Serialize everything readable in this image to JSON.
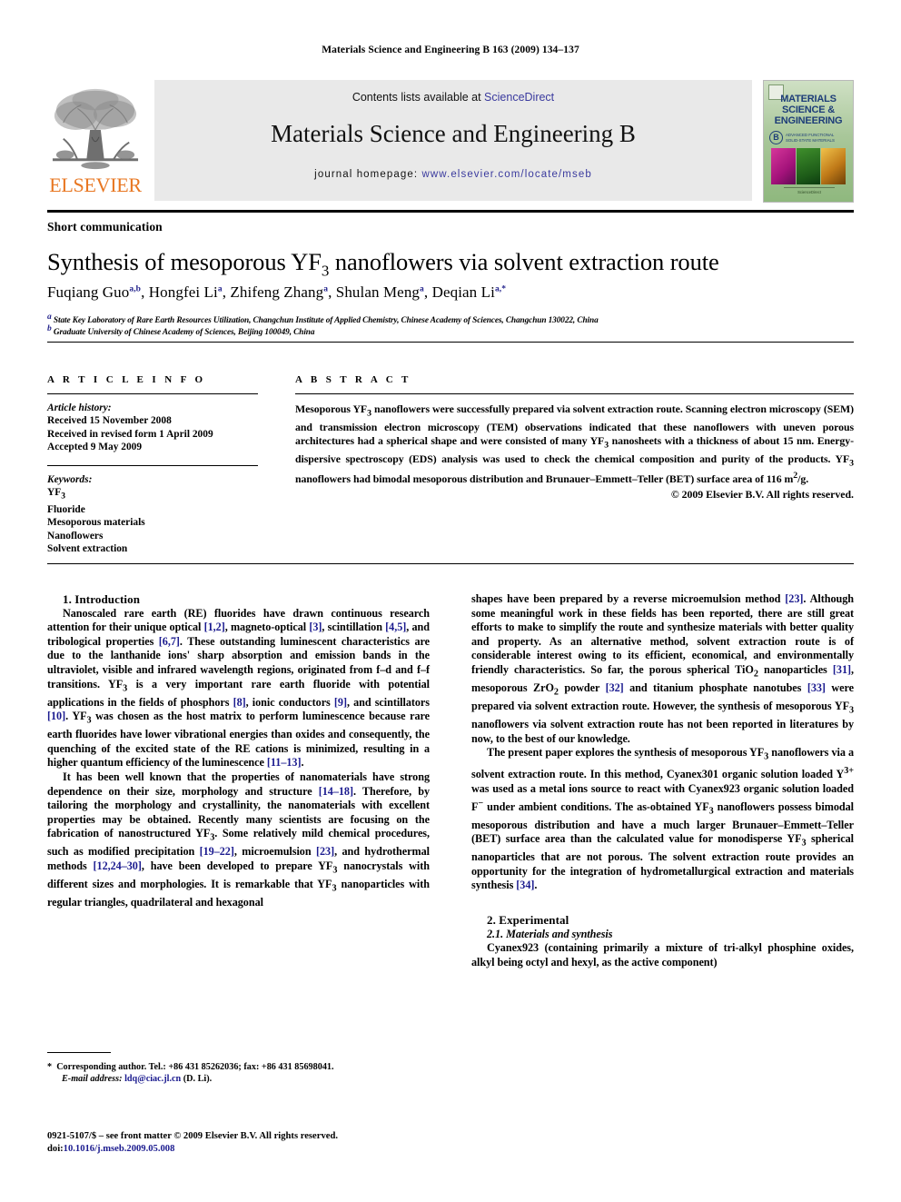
{
  "running_head": "Materials Science and Engineering B 163 (2009) 134–137",
  "masthead": {
    "publisher_name": "ELSEVIER",
    "contents_prefix": "Contents lists available at ",
    "contents_link": "ScienceDirect",
    "journal_title": "Materials Science and Engineering B",
    "homepage_prefix": "journal homepage: ",
    "homepage_url": "www.elsevier.com/locate/mseb",
    "cover": {
      "title": "MATERIALS SCIENCE & ENGINEERING",
      "series_badge": "B",
      "series_text": "ADVANCED FUNCTIONAL SOLID-STATE MATERIALS",
      "footer_text": "ScienceDirect"
    }
  },
  "article": {
    "type": "Short communication",
    "title_part1": "Synthesis of mesoporous YF",
    "title_sub": "3",
    "title_part2": " nanoflowers via solvent extraction route",
    "authors": [
      {
        "name": "Fuqiang Guo",
        "marks": "a,b"
      },
      {
        "name": "Hongfei Li",
        "marks": "a"
      },
      {
        "name": "Zhifeng Zhang",
        "marks": "a"
      },
      {
        "name": "Shulan Meng",
        "marks": "a"
      },
      {
        "name": "Deqian Li",
        "marks": "a,*"
      }
    ],
    "affiliations": [
      {
        "mark": "a",
        "text": "State Key Laboratory of Rare Earth Resources Utilization, Changchun Institute of Applied Chemistry, Chinese Academy of Sciences, Changchun 130022, China"
      },
      {
        "mark": "b",
        "text": "Graduate University of Chinese Academy of Sciences, Beijing 100049, China"
      }
    ]
  },
  "article_info": {
    "heading": "A R T I C L E    I N F O",
    "history_label": "Article history:",
    "history": [
      "Received 15 November 2008",
      "Received in revised form 1 April 2009",
      "Accepted 9 May 2009"
    ],
    "keywords_label": "Keywords:",
    "keywords": [
      "YF3",
      "Fluoride",
      "Mesoporous materials",
      "Nanoflowers",
      "Solvent extraction"
    ]
  },
  "abstract": {
    "heading": "A B S T R A C T",
    "text": "Mesoporous YF3 nanoflowers were successfully prepared via solvent extraction route. Scanning electron microscopy (SEM) and transmission electron microscopy (TEM) observations indicated that these nanoflowers with uneven porous architectures had a spherical shape and were consisted of many YF3 nanosheets with a thickness of about 15 nm. Energy-dispersive spectroscopy (EDS) analysis was used to check the chemical composition and purity of the products. YF3 nanoflowers had bimodal mesoporous distribution and Brunauer–Emmett–Teller (BET) surface area of 116 m2/g.",
    "copyright": "© 2009 Elsevier B.V. All rights reserved."
  },
  "sections": {
    "intro_heading": "1.  Introduction",
    "experimental_heading": "2.  Experimental",
    "materials_heading": "2.1.  Materials and synthesis"
  },
  "body": {
    "p1": "Nanoscaled rare earth (RE) fluorides have drawn continuous research attention for their unique optical [1,2], magneto-optical [3], scintillation [4,5], and tribological properties [6,7]. These outstanding luminescent characteristics are due to the lanthanide ions' sharp absorption and emission bands in the ultraviolet, visible and infrared wavelength regions, originated from f–d and f–f transitions. YF3 is a very important rare earth fluoride with potential applications in the fields of phosphors [8], ionic conductors [9], and scintillators [10]. YF3 was chosen as the host matrix to perform luminescence because rare earth fluorides have lower vibrational energies than oxides and consequently, the quenching of the excited state of the RE cations is minimized, resulting in a higher quantum efficiency of the luminescence [11–13].",
    "p2": "It has been well known that the properties of nanomaterials have strong dependence on their size, morphology and structure [14–18]. Therefore, by tailoring the morphology and crystallinity, the nanomaterials with excellent properties may be obtained. Recently many scientists are focusing on the fabrication of nanostructured YF3. Some relatively mild chemical procedures, such as modified precipitation [19–22], microemulsion [23], and hydrothermal methods [12,24–30], have been developed to prepare YF3 nanocrystals with different sizes and morphologies. It is remarkable that YF3 nanoparticles with regular triangles, quadrilateral and hexagonal",
    "p3": "shapes have been prepared by a reverse microemulsion method [23]. Although some meaningful work in these fields has been reported, there are still great efforts to make to simplify the route and synthesize materials with better quality and property. As an alternative method, solvent extraction route is of considerable interest owing to its efficient, economical, and environmentally friendly characteristics. So far, the porous spherical TiO2 nanoparticles [31], mesoporous ZrO2 powder [32] and titanium phosphate nanotubes [33] were prepared via solvent extraction route. However, the synthesis of mesoporous YF3 nanoflowers via solvent extraction route has not been reported in literatures by now, to the best of our knowledge.",
    "p4": "The present paper explores the synthesis of mesoporous YF3 nanoflowers via a solvent extraction route. In this method, Cyanex301 organic solution loaded Y3+ was used as a metal ions source to react with Cyanex923 organic solution loaded F− under ambient conditions. The as-obtained YF3 nanoflowers possess bimodal mesoporous distribution and have a much larger Brunauer–Emmett–Teller (BET) surface area than the calculated value for monodisperse YF3 spherical nanoparticles that are not porous. The solvent extraction route provides an opportunity for the integration of hydrometallurgical extraction and materials synthesis [34].",
    "p5": "Cyanex923 (containing primarily a mixture of tri-alkyl phosphine oxides, alkyl being octyl and hexyl, as the active component)"
  },
  "footnotes": {
    "corresponding_star": "*",
    "corresponding_text": "Corresponding author. Tel.: +86 431 85262036; fax: +86 431 85698041.",
    "email_label": "E-mail address:",
    "email": "ldq@ciac.jl.cn",
    "email_who": "(D. Li).",
    "issn_line": "0921-5107/$ – see front matter © 2009 Elsevier B.V. All rights reserved.",
    "doi_label": "doi:",
    "doi_value": "10.1016/j.mseb.2009.05.008"
  },
  "colors": {
    "link": "#3a3a9e",
    "citation": "#1b1b8f",
    "elsevier_orange": "#E87722",
    "cover_blue": "#1d3d78"
  }
}
